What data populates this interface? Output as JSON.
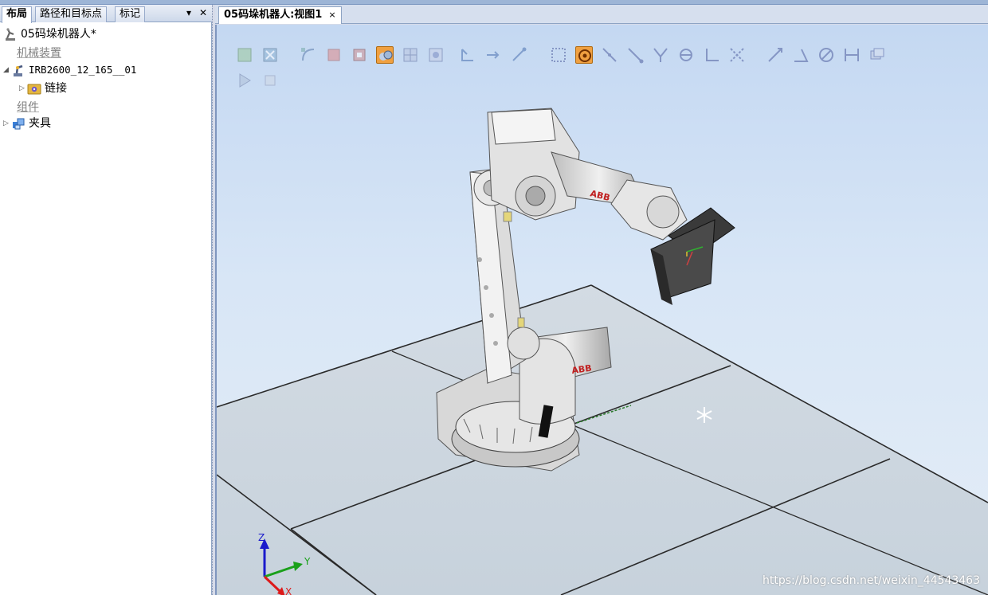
{
  "left_panel": {
    "tabs": [
      {
        "label": "布局",
        "active": true
      },
      {
        "label": "路径和目标点",
        "active": false
      },
      {
        "label": "标记",
        "active": false
      }
    ],
    "tree": {
      "station": "05码垛机器人*",
      "mechanisms_header": "机械装置",
      "robot": "IRB2600_12_165__01",
      "links": "链接",
      "components_header": "组件",
      "tool": "夹具"
    }
  },
  "viewport": {
    "tab_title": "05码垛机器人:视图1",
    "tab_close": "×",
    "axes": {
      "x": "X",
      "y": "Y",
      "z": "Z"
    },
    "brand": "ABB",
    "watermark": "https://blog.csdn.net/weixin_44543463"
  },
  "colors": {
    "accent": "#f0a040",
    "floor": "#cfd8e2",
    "robot": "#e8e8e8"
  }
}
